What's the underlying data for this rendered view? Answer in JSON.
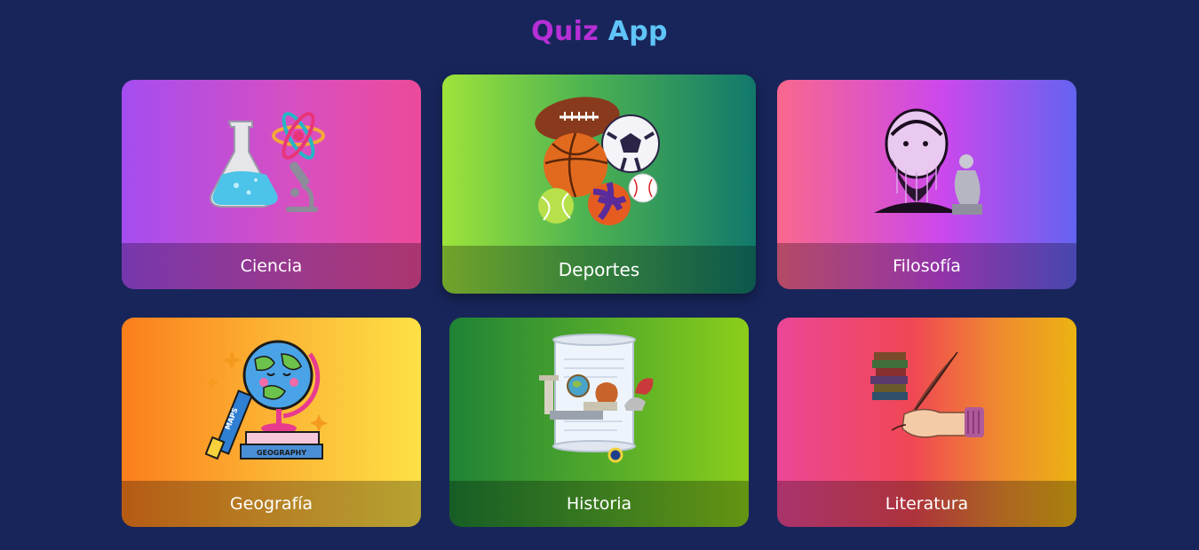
{
  "header": {
    "title_part1": "Quiz",
    "title_part2": "App",
    "title_part1_color": "#b62fd6",
    "title_part2_color": "#5fc4f7"
  },
  "categories": [
    {
      "label": "Ciencia",
      "icon": "science-lab-icon"
    },
    {
      "label": "Deportes",
      "icon": "sports-balls-icon"
    },
    {
      "label": "Filosofía",
      "icon": "philosopher-thinker-icon"
    },
    {
      "label": "Geografía",
      "icon": "globe-maps-books-icon",
      "art_text": [
        "MAPS",
        "GEOGRAPHY"
      ]
    },
    {
      "label": "Historia",
      "icon": "history-scroll-icon"
    },
    {
      "label": "Literatura",
      "icon": "quill-books-icon"
    }
  ],
  "colors": {
    "background": "#18255a"
  }
}
